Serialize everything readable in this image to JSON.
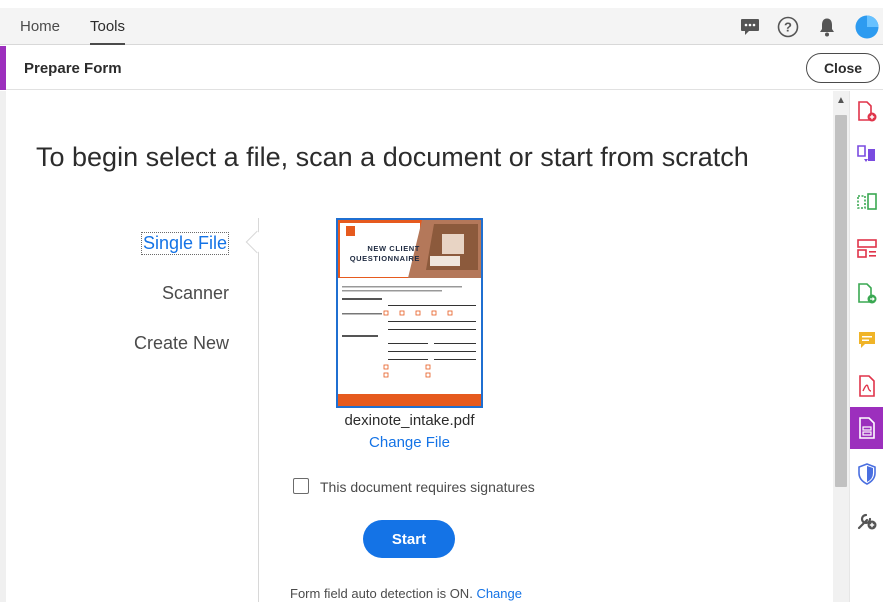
{
  "nav": {
    "tabs": [
      {
        "label": "Home"
      },
      {
        "label": "Tools"
      }
    ],
    "icons": [
      "chat-icon",
      "help-icon",
      "notifications-icon",
      "account-avatar"
    ]
  },
  "tool": {
    "title": "Prepare Form",
    "close_label": "Close",
    "accent_color": "#9c2fbd"
  },
  "main": {
    "headline": "To begin select a file, scan a document or start from scratch",
    "options": [
      {
        "label": "Single File"
      },
      {
        "label": "Scanner"
      },
      {
        "label": "Create New"
      }
    ],
    "file": {
      "name": "dexinote_intake.pdf",
      "change_label": "Change File"
    },
    "thumbnail": {
      "heading_line1": "NEW CLIENT",
      "heading_line2": "QUESTIONNAIRE"
    },
    "signatures_label": "This document requires signatures",
    "start_label": "Start",
    "auto_detect": {
      "text": "Form field auto detection is ON.",
      "link": "Change"
    }
  },
  "colors": {
    "primary_blue": "#1473e6",
    "form_orange": "#e65a1e"
  },
  "rail": {
    "tools": [
      "create-pdf-icon",
      "combine-files-icon",
      "organize-pages-icon",
      "edit-pdf-icon",
      "export-pdf-icon",
      "comment-icon",
      "adobe-pdf-icon",
      "prepare-form-icon",
      "protect-icon",
      "more-tools-icon"
    ]
  }
}
